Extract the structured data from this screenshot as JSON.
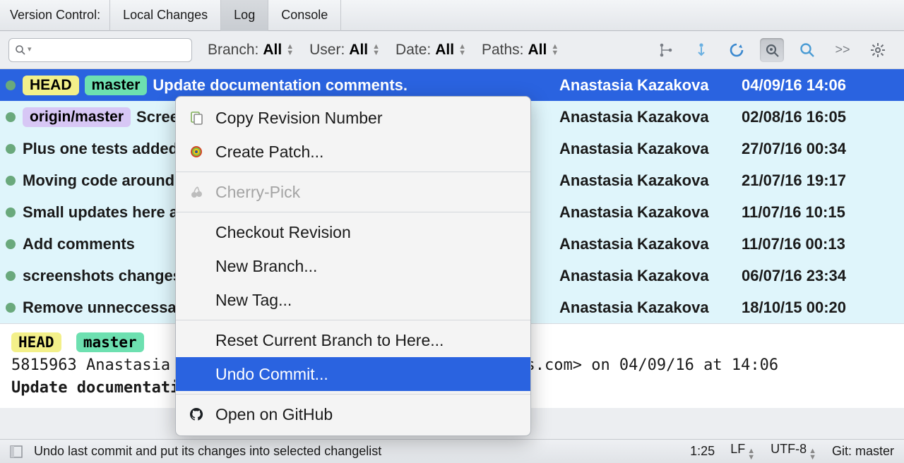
{
  "tabbar": {
    "title": "Version Control:",
    "tabs": [
      {
        "label": "Local Changes"
      },
      {
        "label": "Log"
      },
      {
        "label": "Console"
      }
    ],
    "active": 1
  },
  "filters": {
    "branch": {
      "label": "Branch:",
      "value": "All"
    },
    "user": {
      "label": "User:",
      "value": "All"
    },
    "date": {
      "label": "Date:",
      "value": "All"
    },
    "paths": {
      "label": "Paths:",
      "value": "All"
    }
  },
  "more_icon": ">>",
  "commits": [
    {
      "badges": [
        "HEAD",
        "master"
      ],
      "msg": "Update documentation comments.",
      "author": "Anastasia Kazakova",
      "date": "04/09/16 14:06",
      "selected": true
    },
    {
      "badges": [
        "origin/master"
      ],
      "msg": "Screenshots tests",
      "author": "Anastasia Kazakova",
      "date": "02/08/16 16:05"
    },
    {
      "msg": "Plus one tests added",
      "author": "Anastasia Kazakova",
      "date": "27/07/16 00:34"
    },
    {
      "msg": "Moving code around for tips",
      "author": "Anastasia Kazakova",
      "date": "21/07/16 19:17"
    },
    {
      "msg": "Small updates here and there.",
      "author": "Anastasia Kazakova",
      "date": "11/07/16 10:15"
    },
    {
      "msg": "Add comments",
      "author": "Anastasia Kazakova",
      "date": "11/07/16 00:13"
    },
    {
      "msg": "screenshots changes",
      "author": "Anastasia Kazakova",
      "date": "06/07/16 23:34"
    },
    {
      "msg": "Remove unneccessary lines from CMakeLists.txt files",
      "author": "Anastasia Kazakova",
      "date": "18/10/15 00:20"
    }
  ],
  "details": {
    "badges": [
      "HEAD",
      "master"
    ],
    "line1": "5815963 Anastasia Kazakova <anastasia.kazakova@jetbrains.com> on 04/09/16 at 14:06",
    "line2": "Update documentation comments."
  },
  "context": {
    "items": [
      {
        "icon": "copy",
        "label": "Copy Revision Number"
      },
      {
        "icon": "patch",
        "label": "Create Patch..."
      },
      {
        "sep": true
      },
      {
        "icon": "cherry",
        "label": "Cherry-Pick",
        "disabled": true
      },
      {
        "sep": true
      },
      {
        "label": "Checkout Revision"
      },
      {
        "label": "New Branch..."
      },
      {
        "label": "New Tag..."
      },
      {
        "sep": true
      },
      {
        "label": "Reset Current Branch to Here..."
      },
      {
        "label": "Undo Commit...",
        "selected": true
      },
      {
        "sep": true
      },
      {
        "icon": "github",
        "label": "Open on GitHub"
      }
    ]
  },
  "status": {
    "hint": "Undo last commit and put its changes into selected changelist",
    "pos": "1:25",
    "le": "LF",
    "enc": "UTF-8",
    "branch": "Git: master"
  }
}
